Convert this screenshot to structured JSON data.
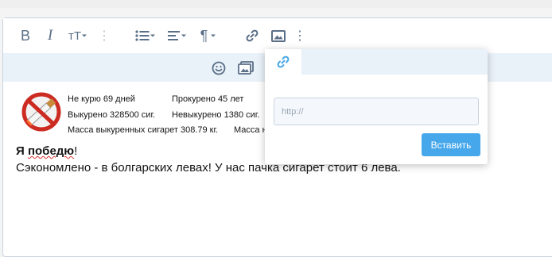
{
  "toolbar": {
    "bold": "B",
    "italic": "I",
    "text_size": "тT",
    "more_dots": "⋮",
    "paragraph": "¶"
  },
  "signature": {
    "row1_col1": "Не курю 69 дней",
    "row1_col2": "Прокурено 45 лет",
    "row2_col1": "Выкурено 328500 сиг.",
    "row2_col2": "Невыкурено 1380 сиг.",
    "row3_col1": "Масса выкуренных сигарет 308.79 кг.",
    "row3_col2": "Масса н"
  },
  "content": {
    "bold_prefix": "Я ",
    "bold_word": "победю",
    "bold_suffix": "!",
    "body_line": "Сэкономлено - в болгарских левах! У нас пачка сигарет стоит 6 лева."
  },
  "link_popup": {
    "url_placeholder": "http://",
    "url_value": "",
    "insert_label": "Вставить"
  },
  "colors": {
    "accent": "#47a7eb",
    "toolbar_icon": "#5a6f88",
    "subbar_bg": "#e9f1f9"
  }
}
